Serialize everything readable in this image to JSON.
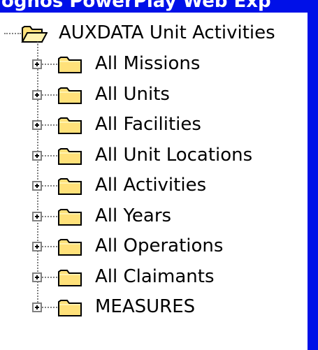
{
  "window": {
    "title": "ognos PowerPlay Web Exp"
  },
  "tree": {
    "root": {
      "label": "AUXDATA Unit Activities",
      "icon": "open-folder-icon",
      "expander": "minus"
    },
    "children": [
      {
        "label": "All Missions",
        "icon": "folder-icon",
        "expander": "plus"
      },
      {
        "label": "All Units",
        "icon": "folder-icon",
        "expander": "plus"
      },
      {
        "label": "All Facilities",
        "icon": "folder-icon",
        "expander": "plus"
      },
      {
        "label": "All Unit Locations",
        "icon": "folder-icon",
        "expander": "plus"
      },
      {
        "label": "All Activities",
        "icon": "folder-icon",
        "expander": "plus"
      },
      {
        "label": "All Years",
        "icon": "folder-icon",
        "expander": "plus"
      },
      {
        "label": "All Operations",
        "icon": "folder-icon",
        "expander": "plus"
      },
      {
        "label": "All Claimants",
        "icon": "folder-icon",
        "expander": "plus"
      },
      {
        "label": "MEASURES",
        "icon": "folder-icon",
        "expander": "plus"
      }
    ]
  },
  "colors": {
    "frame": "#0010e8",
    "panel": "#ffffff",
    "folder": "#ffe17a",
    "folder_outline": "#000000",
    "tree_lines": "#808080"
  }
}
